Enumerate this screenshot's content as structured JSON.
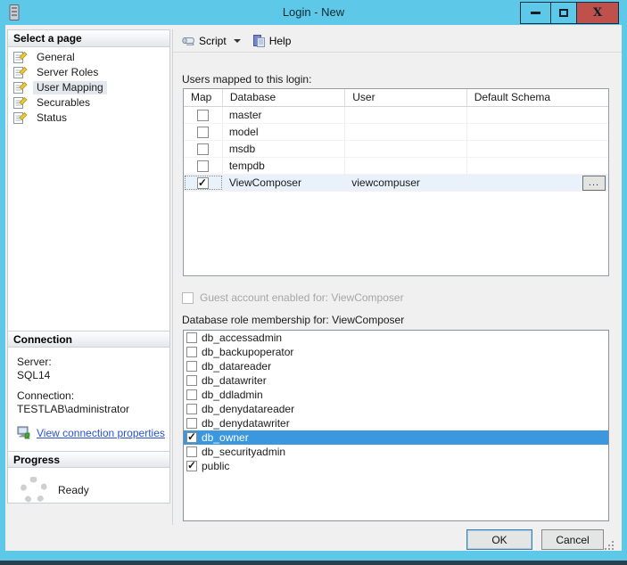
{
  "window": {
    "title": "Login - New",
    "controls": {
      "close": "X"
    }
  },
  "toolbar": {
    "script_label": "Script",
    "help_label": "Help"
  },
  "sidebar": {
    "select_page": {
      "header": "Select a page",
      "items": [
        {
          "label": "General",
          "selected": false
        },
        {
          "label": "Server Roles",
          "selected": false
        },
        {
          "label": "User Mapping",
          "selected": true
        },
        {
          "label": "Securables",
          "selected": false
        },
        {
          "label": "Status",
          "selected": false
        }
      ]
    },
    "connection": {
      "header": "Connection",
      "server_label": "Server:",
      "server_value": "SQL14",
      "connection_label": "Connection:",
      "connection_value": "TESTLAB\\administrator",
      "link_label": "View connection properties"
    },
    "progress": {
      "header": "Progress",
      "status": "Ready"
    }
  },
  "main": {
    "users_caption": "Users mapped to this login:",
    "users_table": {
      "columns": [
        {
          "label": "Map"
        },
        {
          "label": "Database"
        },
        {
          "label": "User"
        },
        {
          "label": "Default Schema"
        }
      ],
      "rows": [
        {
          "map": false,
          "database": "master",
          "user": "",
          "schema": ""
        },
        {
          "map": false,
          "database": "model",
          "user": "",
          "schema": ""
        },
        {
          "map": false,
          "database": "msdb",
          "user": "",
          "schema": ""
        },
        {
          "map": false,
          "database": "tempdb",
          "user": "",
          "schema": ""
        },
        {
          "map": true,
          "selected": true,
          "database": "ViewComposer",
          "user": "viewcompuser",
          "schema": "",
          "browse": "..."
        }
      ]
    },
    "guest_label": "Guest account enabled for: ViewComposer",
    "roles_caption": "Database role membership for: ViewComposer",
    "roles": [
      {
        "label": "db_accessadmin",
        "checked": false
      },
      {
        "label": "db_backupoperator",
        "checked": false
      },
      {
        "label": "db_datareader",
        "checked": false
      },
      {
        "label": "db_datawriter",
        "checked": false
      },
      {
        "label": "db_ddladmin",
        "checked": false
      },
      {
        "label": "db_denydatareader",
        "checked": false
      },
      {
        "label": "db_denydatawriter",
        "checked": false
      },
      {
        "label": "db_owner",
        "checked": true,
        "selected": true
      },
      {
        "label": "db_securityadmin",
        "checked": false
      },
      {
        "label": "public",
        "checked": true
      }
    ]
  },
  "footer": {
    "ok_label": "OK",
    "cancel_label": "Cancel"
  },
  "colors": {
    "titlebar": "#5ec8e8",
    "close_button": "#bf504b",
    "selection_blue": "#3b97de",
    "selected_row_highlight": "#e9f2fa",
    "link_blue": "#2a52cc",
    "bottom_edge": "#27404b"
  }
}
